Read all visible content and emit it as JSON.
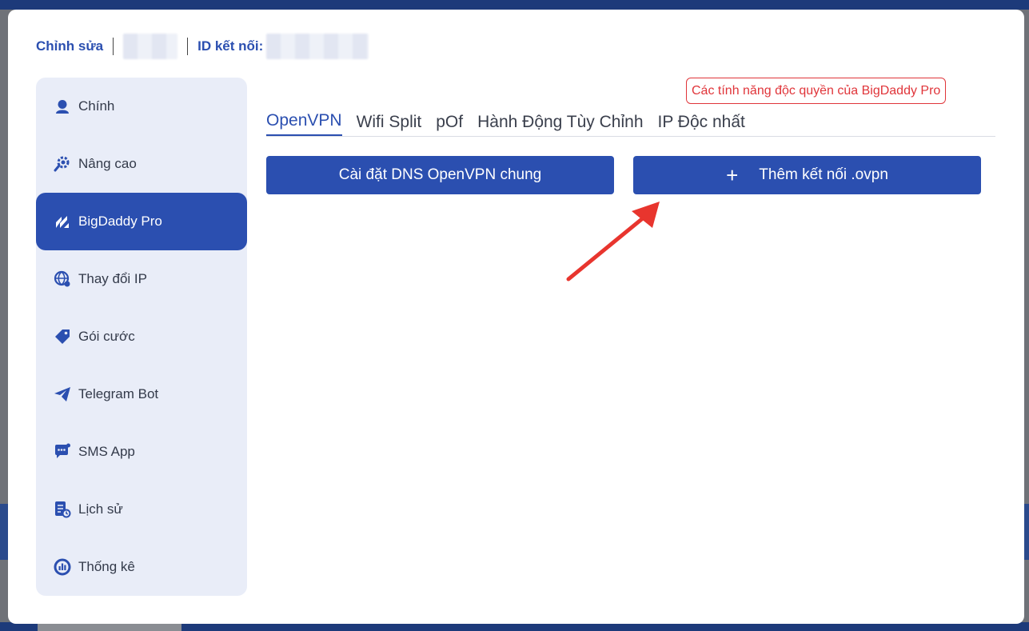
{
  "header": {
    "edit_label": "Chỉnh sửa",
    "id_label": "ID kết nối:"
  },
  "sidebar": {
    "items": [
      {
        "label": "Chính",
        "icon": "user-icon"
      },
      {
        "label": "Nâng cao",
        "icon": "gear-search-icon"
      },
      {
        "label": "BigDaddy Pro",
        "icon": "bigdaddy-logo-icon",
        "active": true
      },
      {
        "label": "Thay đổi IP",
        "icon": "globe-icon"
      },
      {
        "label": "Gói cước",
        "icon": "tag-icon"
      },
      {
        "label": "Telegram Bot",
        "icon": "telegram-icon"
      },
      {
        "label": "SMS App",
        "icon": "chat-icon"
      },
      {
        "label": "Lịch sử",
        "icon": "history-icon"
      },
      {
        "label": "Thống kê",
        "icon": "stats-icon"
      }
    ]
  },
  "pro_badge": "Các tính năng độc quyền của BigDaddy Pro",
  "tabs": [
    {
      "label": "OpenVPN",
      "active": true
    },
    {
      "label": "Wifi Split"
    },
    {
      "label": "pOf"
    },
    {
      "label": "Hành Động Tùy Chỉnh"
    },
    {
      "label": "IP Độc nhất"
    }
  ],
  "buttons": {
    "dns_label": "Cài đặt DNS OpenVPN chung",
    "add_label": "Thêm kết nối .ovpn",
    "add_icon": "plus-icon"
  },
  "colors": {
    "primary": "#2b4fb0",
    "sidebar_bg": "#e9edf8",
    "badge_red": "#e0353a",
    "arrow_red": "#e8352e"
  }
}
